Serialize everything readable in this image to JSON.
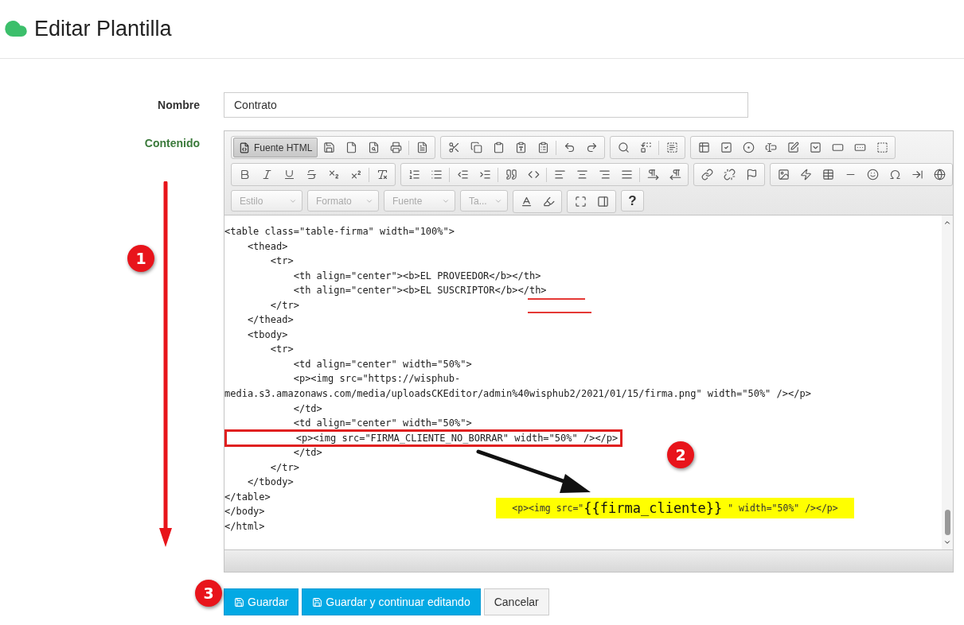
{
  "page": {
    "title": "Editar Plantilla"
  },
  "form": {
    "name_label": "Nombre",
    "name_value": "Contrato",
    "content_label": "Contenido"
  },
  "toolbar": {
    "source_button": "Fuente HTML",
    "combos": [
      "Estilo",
      "Formato",
      "Fuente",
      "Ta..."
    ],
    "help": "?"
  },
  "code_lines": [
    {
      "text": "<table class=\"table-firma\" width=\"100%\">",
      "kind": "plain"
    },
    {
      "text": "    <thead>",
      "kind": "plain"
    },
    {
      "text": "        <tr>",
      "kind": "plain"
    },
    {
      "text": "            <th align=\"center\"><b>EL PROVEEDOR</b></th>",
      "kind": "plain"
    },
    {
      "text": "            <th align=\"center\"><b>EL SUSCRIPTOR</b></th>",
      "kind": "plain"
    },
    {
      "text": "        </tr>",
      "kind": "plain"
    },
    {
      "text": "    </thead>",
      "kind": "plain"
    },
    {
      "text": "    <tbody>",
      "kind": "plain"
    },
    {
      "text": "        <tr>",
      "kind": "plain"
    },
    {
      "text": "            <td align=\"center\" width=\"50%\">",
      "kind": "plain"
    },
    {
      "text": "            <p><img src=\"https://wisphub-",
      "kind": "plain"
    },
    {
      "text": "media.s3.amazonaws.com/media/uploadsCKEditor/admin%40wisphub2/2021/01/15/firma.png\" width=\"50%\" /></p>",
      "kind": "plain"
    },
    {
      "text": "            </td>",
      "kind": "plain"
    },
    {
      "text": "            <td align=\"center\" width=\"50%\">",
      "kind": "plain"
    },
    {
      "text": "            <p><img src=\"FIRMA_CLIENTE_NO_BORRAR\" width=\"50%\" /></p>",
      "kind": "boxed"
    },
    {
      "text": "            </td>",
      "kind": "plain"
    },
    {
      "text": "        </tr>",
      "kind": "plain"
    },
    {
      "text": "    </tbody>",
      "kind": "plain"
    },
    {
      "text": "</table>",
      "kind": "plain"
    },
    {
      "text": "</body>",
      "kind": "plain"
    },
    {
      "text": "</html>",
      "kind": "plain"
    }
  ],
  "annotations": {
    "steps": [
      "1",
      "2",
      "3"
    ],
    "replacement": {
      "before": "<p><img src=\"",
      "highlight": "{{firma_cliente}}",
      "after": " \" width=\"50%\" /></p>"
    }
  },
  "buttons": [
    {
      "label": "Guardar",
      "kind": "primary"
    },
    {
      "label": "Guardar y continuar editando",
      "kind": "primary"
    },
    {
      "label": "Cancelar",
      "kind": "default"
    }
  ]
}
